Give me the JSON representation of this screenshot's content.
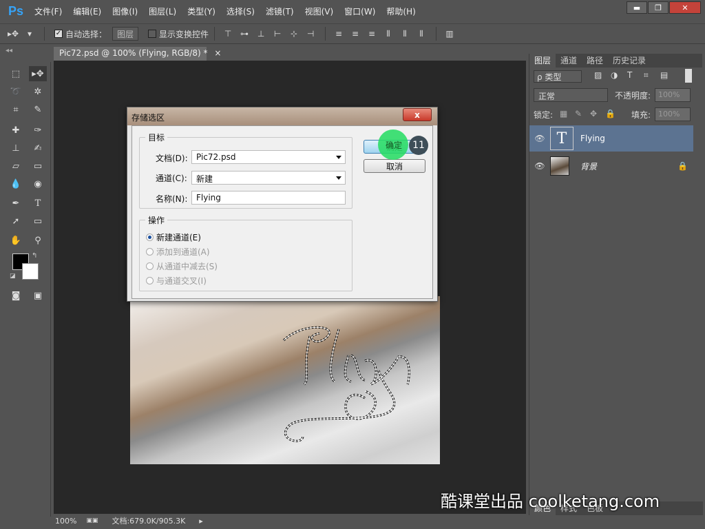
{
  "app": {
    "logo": "Ps"
  },
  "menu": [
    "文件(F)",
    "编辑(E)",
    "图像(I)",
    "图层(L)",
    "类型(Y)",
    "选择(S)",
    "滤镜(T)",
    "视图(V)",
    "窗口(W)",
    "帮助(H)"
  ],
  "window_controls": {
    "minimize": "▬",
    "maximize": "❐",
    "close": "✕"
  },
  "options": {
    "auto_select_label": "自动选择：",
    "auto_select_value": "图层",
    "show_transform_label": "显示变换控件"
  },
  "document": {
    "tab_title": "Pic72.psd @ 100% (Flying, RGB/8) *",
    "tab_close": "×",
    "artwork_text": "Flying"
  },
  "status": {
    "zoom": "100%",
    "doc_size": "文档:679.0K/905.3K"
  },
  "layers_panel": {
    "tabs": [
      "图层",
      "通道",
      "路径",
      "历史记录"
    ],
    "filter_label": "ρ 类型",
    "blend_mode": "正常",
    "opacity_label": "不透明度:",
    "opacity_value": "100%",
    "lock_label": "锁定:",
    "fill_label": "填充:",
    "fill_value": "100%",
    "layers": [
      {
        "name": "Flying",
        "type_glyph": "T"
      },
      {
        "name": "背景"
      }
    ]
  },
  "bottom_panel": {
    "tabs": [
      "颜色",
      "样式",
      "色板"
    ]
  },
  "dialog": {
    "title": "存储选区",
    "close_label": "x",
    "target_legend": "目标",
    "doc_label": "文档(D):",
    "doc_value": "Pic72.psd",
    "channel_label": "通道(C):",
    "channel_value": "新建",
    "name_label": "名称(N):",
    "name_value": "Flying",
    "operation_legend": "操作",
    "operations": [
      {
        "label": "新建通道(E)",
        "checked": true,
        "enabled": true
      },
      {
        "label": "添加到通道(A)",
        "checked": false,
        "enabled": false
      },
      {
        "label": "从通道中减去(S)",
        "checked": false,
        "enabled": false
      },
      {
        "label": "与通道交叉(I)",
        "checked": false,
        "enabled": false
      }
    ],
    "ok_label": "确定",
    "cancel_label": "取消",
    "step_badge": "11"
  },
  "watermark": "酷课堂出品 coolketang.com",
  "colors": {
    "ui_bg": "#535353",
    "canvas_bg": "#282828",
    "highlight_green": "#3bd66b",
    "selected_layer": "#5c7391"
  }
}
